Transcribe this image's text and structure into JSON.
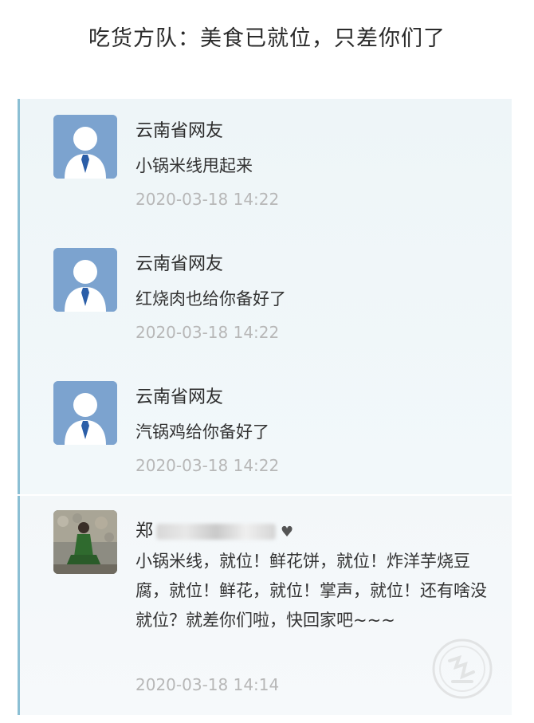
{
  "page_title": "吃货方队：美食已就位，只差你们了",
  "comments": [
    {
      "username": "云南省网友",
      "text": "小锅米线甩起来",
      "timestamp": "2020-03-18 14:22",
      "avatar": "default-user-avatar"
    },
    {
      "username": "云南省网友",
      "text": "红烧肉也给你备好了",
      "timestamp": "2020-03-18 14:22",
      "avatar": "default-user-avatar"
    },
    {
      "username": "云南省网友",
      "text": "汽锅鸡给你备好了",
      "timestamp": "2020-03-18 14:22",
      "avatar": "default-user-avatar"
    },
    {
      "username": "郑",
      "text": "小锅米线，就位！鲜花饼，就位！炸洋芋烧豆腐，就位！鲜花，就位！掌声，就位！还有啥没就位？就差你们啦，快回家吧~~~",
      "timestamp": "2020-03-18 14:14",
      "avatar": "photo-avatar",
      "name_suffix_icon": "heart-icon"
    }
  ],
  "colors": {
    "accent_border": "#8bbfd4",
    "timestamp": "#b7b7b7"
  }
}
